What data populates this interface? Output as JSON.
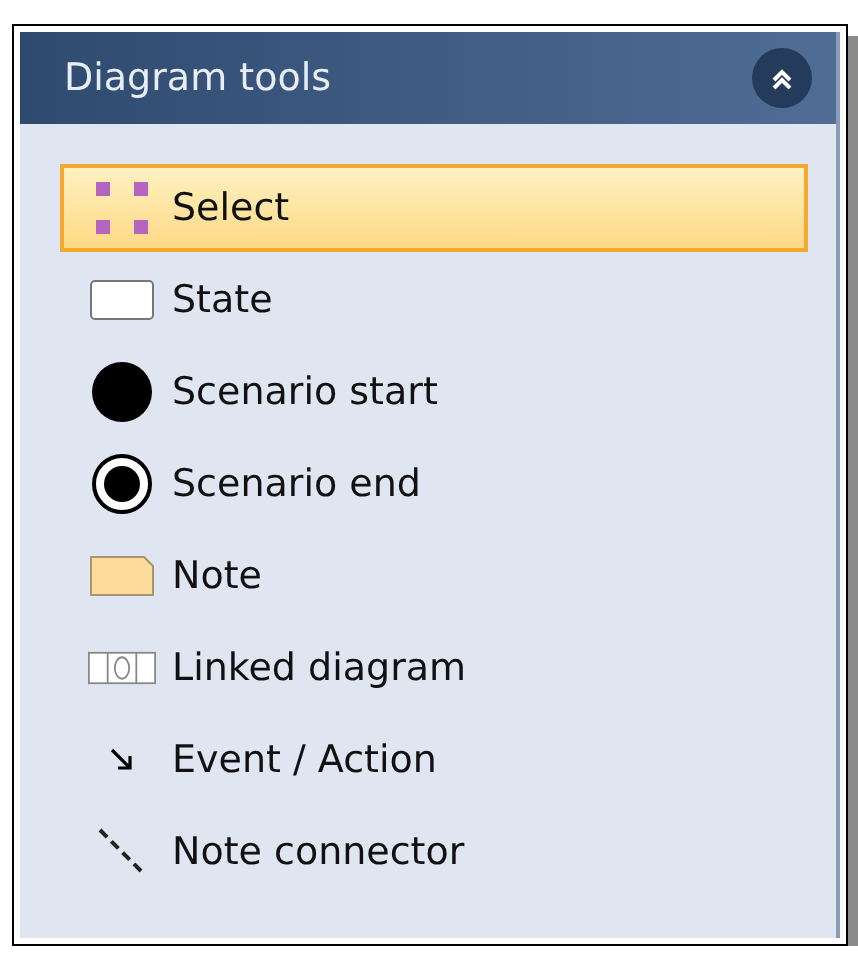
{
  "panel": {
    "title": "Diagram tools"
  },
  "tools": [
    {
      "label": "Select",
      "kind": "select",
      "selected": true
    },
    {
      "label": "State",
      "kind": "state",
      "selected": false
    },
    {
      "label": "Scenario start",
      "kind": "start",
      "selected": false
    },
    {
      "label": "Scenario end",
      "kind": "end",
      "selected": false
    },
    {
      "label": "Note",
      "kind": "note",
      "selected": false
    },
    {
      "label": "Linked diagram",
      "kind": "linked",
      "selected": false
    },
    {
      "label": "Event / Action",
      "kind": "event",
      "selected": false
    },
    {
      "label": "Note connector",
      "kind": "connector",
      "selected": false
    }
  ]
}
